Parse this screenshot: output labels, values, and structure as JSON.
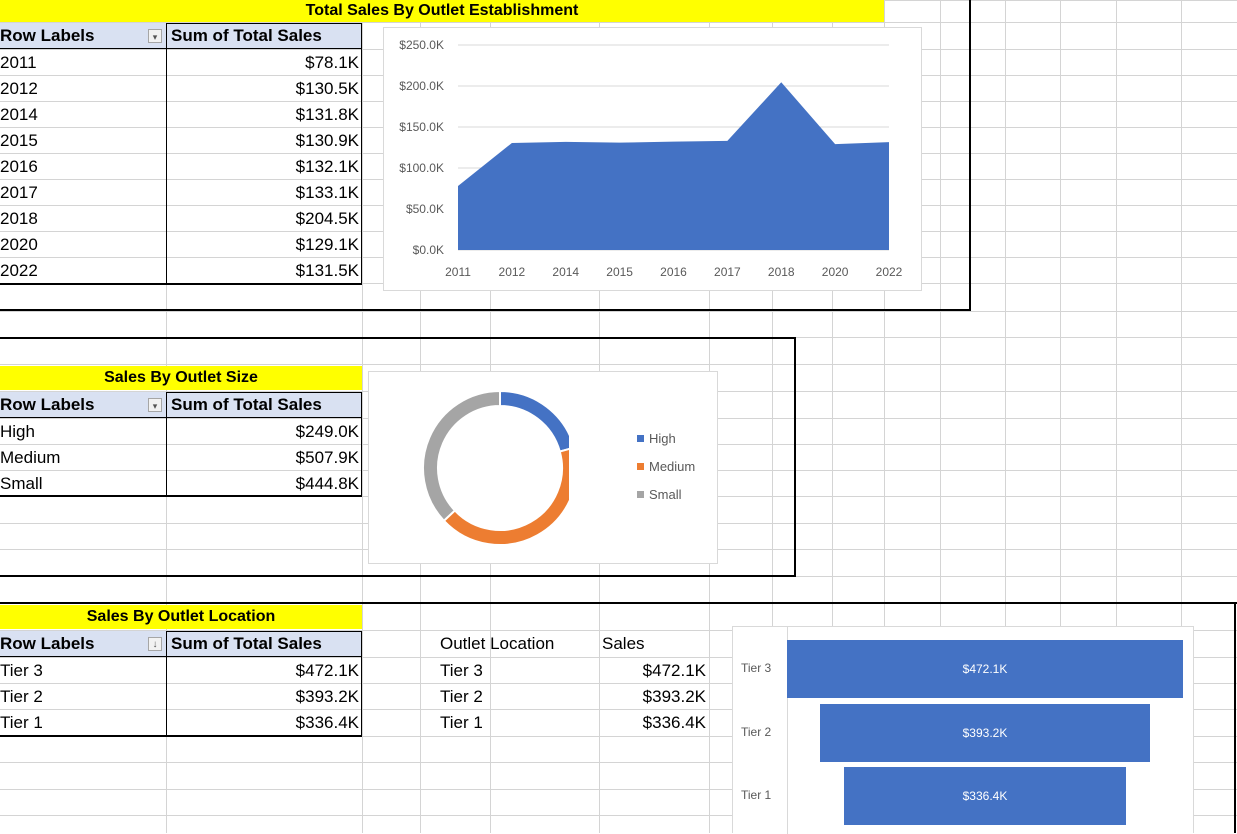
{
  "colors": {
    "area": "#4472c4",
    "high": "#4472c4",
    "medium": "#ed7d31",
    "small": "#a5a5a5",
    "title_bg": "#ffff00",
    "header_bg": "#d9e1f2"
  },
  "establishment": {
    "title": "Total Sales By Outlet Establishment",
    "header_row_labels": "Row Labels",
    "header_sum": "Sum of Total Sales",
    "rows": [
      {
        "label": "2011",
        "value": "$78.1K"
      },
      {
        "label": "2012",
        "value": "$130.5K"
      },
      {
        "label": "2014",
        "value": "$131.8K"
      },
      {
        "label": "2015",
        "value": "$130.9K"
      },
      {
        "label": "2016",
        "value": "$132.1K"
      },
      {
        "label": "2017",
        "value": "$133.1K"
      },
      {
        "label": "2018",
        "value": "$204.5K"
      },
      {
        "label": "2020",
        "value": "$129.1K"
      },
      {
        "label": "2022",
        "value": "$131.5K"
      }
    ]
  },
  "size": {
    "title": "Sales By Outlet Size",
    "header_row_labels": "Row Labels",
    "header_sum": "Sum of Total Sales",
    "rows": [
      {
        "label": "High",
        "value": "$249.0K"
      },
      {
        "label": "Medium",
        "value": "$507.9K"
      },
      {
        "label": "Small",
        "value": "$444.8K"
      }
    ],
    "legend": [
      "High",
      "Medium",
      "Small"
    ]
  },
  "location": {
    "title": "Sales By Outlet Location",
    "header_row_labels": "Row Labels",
    "header_sum": "Sum of Total Sales",
    "rows": [
      {
        "label": "Tier 3",
        "value": "$472.1K"
      },
      {
        "label": "Tier 2",
        "value": "$393.2K"
      },
      {
        "label": "Tier 1",
        "value": "$336.4K"
      }
    ],
    "side_table": {
      "header_location": "Outlet Location",
      "header_sales": "Sales",
      "rows": [
        {
          "label": "Tier 3",
          "value": "$472.1K"
        },
        {
          "label": "Tier 2",
          "value": "$393.2K"
        },
        {
          "label": "Tier 1",
          "value": "$336.4K"
        }
      ]
    }
  },
  "chart_data": [
    {
      "type": "area",
      "categories": [
        "2011",
        "2012",
        "2014",
        "2015",
        "2016",
        "2017",
        "2018",
        "2020",
        "2022"
      ],
      "values": [
        78.1,
        130.5,
        131.8,
        130.9,
        132.1,
        133.1,
        204.5,
        129.1,
        131.5
      ],
      "unit": "K",
      "ylim": [
        0,
        250
      ],
      "ytick_labels": [
        "$0.0K",
        "$50.0K",
        "$100.0K",
        "$150.0K",
        "$200.0K",
        "$250.0K"
      ],
      "grid": true,
      "title": ""
    },
    {
      "type": "pie",
      "donut": true,
      "labels": [
        "High",
        "Medium",
        "Small"
      ],
      "values": [
        249.0,
        507.9,
        444.8
      ],
      "legend": "right",
      "title": ""
    },
    {
      "type": "bar",
      "funnel": true,
      "categories": [
        "Tier 3",
        "Tier 2",
        "Tier 1"
      ],
      "values": [
        472.1,
        393.2,
        336.4
      ],
      "data_labels": [
        "$472.1K",
        "$393.2K",
        "$336.4K"
      ],
      "title": ""
    }
  ]
}
